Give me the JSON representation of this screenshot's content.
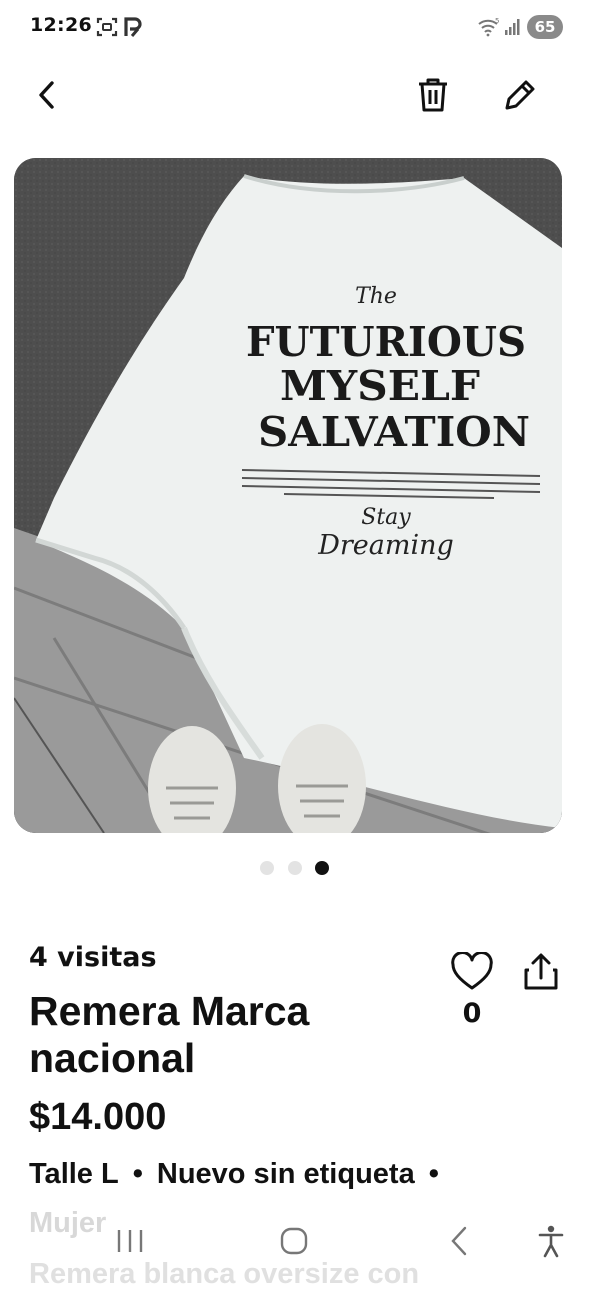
{
  "status_bar": {
    "time": "12:26",
    "battery": "65"
  },
  "header": {
    "back_icon": "chevron-left-icon",
    "delete_icon": "trash-icon",
    "edit_icon": "pencil-icon"
  },
  "gallery": {
    "image_text": {
      "line0": "The",
      "line1": "FUTURIOUS",
      "line2": "MYSELF",
      "line3": "SALVATION",
      "script1": "Stay",
      "script2": "Dreaming"
    },
    "page_count": 3,
    "active_index": 2
  },
  "listing": {
    "visits": "4 visitas",
    "title": "Remera Marca nacional",
    "price": "$14.000",
    "size": "Talle L",
    "condition": "Nuevo sin etiqueta",
    "gender": "Mujer",
    "description_preview": "Remera blanca oversize con",
    "likes": "0"
  },
  "nav_bar": {
    "recents_icon": "recents-icon",
    "home_icon": "home-icon",
    "back_icon": "back-icon",
    "accessibility_icon": "accessibility-icon"
  }
}
